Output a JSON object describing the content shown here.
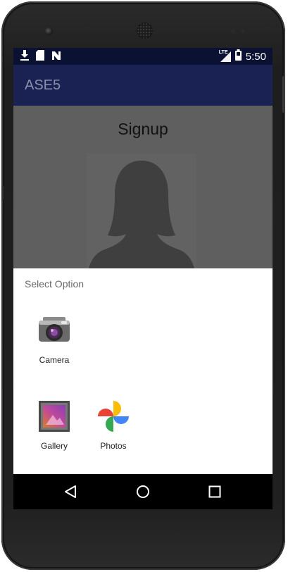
{
  "status_bar": {
    "network_label": "LTE",
    "time": "5:50",
    "left_icons": [
      "download-icon",
      "sd-card-icon",
      "nfc-icon"
    ],
    "right_icons": [
      "signal-icon",
      "battery-icon"
    ]
  },
  "app_bar": {
    "title": "ASE5",
    "color": "#1a2253"
  },
  "screen": {
    "title": "Signup"
  },
  "dialog": {
    "title": "Select Option",
    "options": [
      {
        "label": "Camera",
        "icon": "camera-icon"
      },
      {
        "label": "Gallery",
        "icon": "gallery-icon"
      },
      {
        "label": "Photos",
        "icon": "photos-icon"
      }
    ]
  },
  "nav_bar": {
    "buttons": [
      "back-icon",
      "home-icon",
      "recents-icon"
    ]
  }
}
